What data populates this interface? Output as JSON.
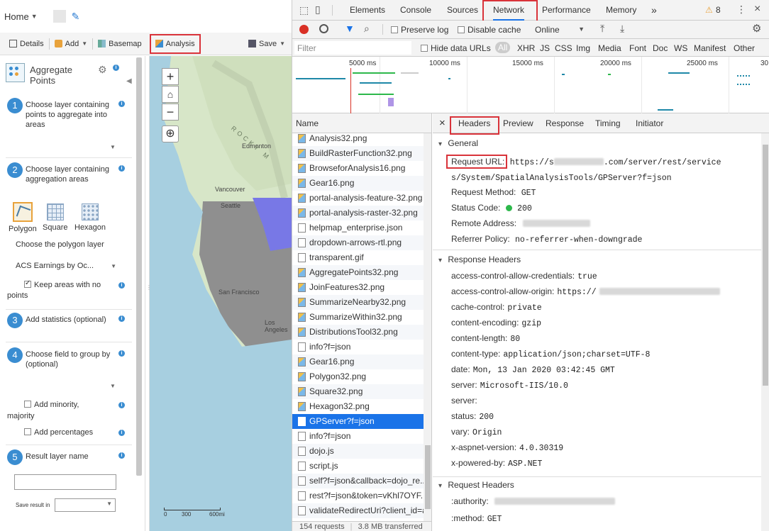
{
  "viewer": {
    "home_label": "Home",
    "toolbar": {
      "details": "Details",
      "add": "Add",
      "basemap": "Basemap",
      "analysis": "Analysis",
      "save": "Save"
    },
    "panel": {
      "title": "Aggregate Points",
      "steps": [
        {
          "num": "1",
          "text": "Choose layer containing points to aggregate into areas"
        },
        {
          "num": "2",
          "text": "Choose layer containing aggregation areas"
        },
        {
          "num": "3",
          "text": "Add statistics (optional)"
        },
        {
          "num": "4",
          "text": "Choose field to group by (optional)"
        },
        {
          "num": "5",
          "text": "Result layer name"
        }
      ],
      "shapes": [
        "Polygon",
        "Square",
        "Hexagon"
      ],
      "choose_polygon": "Choose the polygon layer",
      "polygon_layer": "ACS Earnings by Oc...",
      "keep_areas": "Keep areas with no",
      "keep_areas_2": "points",
      "add_minority": "Add minority,",
      "add_minority_2": "majority",
      "add_percentages": "Add percentages",
      "save_result_in": "Save result in"
    },
    "map": {
      "labels": [
        "Edmonton",
        "Vancouver",
        "Seattle",
        "San Francisco",
        "Los Angeles",
        "ROCKY M"
      ],
      "scale_labels": [
        "0",
        "300",
        "600mi"
      ]
    }
  },
  "devtools": {
    "tabs": [
      "Elements",
      "Console",
      "Sources",
      "Network",
      "Performance",
      "Memory"
    ],
    "active_tab": "Network",
    "more_tabs": "»",
    "warnings": "8",
    "toolbar": {
      "preserve_log": "Preserve log",
      "disable_cache": "Disable cache",
      "throttle": "Online"
    },
    "filter": {
      "placeholder": "Filter",
      "hide_data_urls": "Hide data URLs",
      "types": [
        "All",
        "XHR",
        "JS",
        "CSS",
        "Img",
        "Media",
        "Font",
        "Doc",
        "WS",
        "Manifest",
        "Other"
      ]
    },
    "timeline_ticks": [
      "5000 ms",
      "10000 ms",
      "15000 ms",
      "20000 ms",
      "25000 ms",
      "30"
    ],
    "requests_header": "Name",
    "requests": [
      {
        "name": "Analysis32.png",
        "type": "img"
      },
      {
        "name": "BuildRasterFunction32.png",
        "type": "img"
      },
      {
        "name": "BrowseforAnalysis16.png",
        "type": "img"
      },
      {
        "name": "Gear16.png",
        "type": "img"
      },
      {
        "name": "portal-analysis-feature-32.png",
        "type": "img"
      },
      {
        "name": "portal-analysis-raster-32.png",
        "type": "img"
      },
      {
        "name": "helpmap_enterprise.json",
        "type": "doc"
      },
      {
        "name": "dropdown-arrows-rtl.png",
        "type": "doc"
      },
      {
        "name": "transparent.gif",
        "type": "doc"
      },
      {
        "name": "AggregatePoints32.png",
        "type": "img"
      },
      {
        "name": "JoinFeatures32.png",
        "type": "img"
      },
      {
        "name": "SummarizeNearby32.png",
        "type": "img"
      },
      {
        "name": "SummarizeWithin32.png",
        "type": "img"
      },
      {
        "name": "DistributionsTool32.png",
        "type": "img"
      },
      {
        "name": "info?f=json",
        "type": "doc"
      },
      {
        "name": "Gear16.png",
        "type": "img"
      },
      {
        "name": "Polygon32.png",
        "type": "img"
      },
      {
        "name": "Square32.png",
        "type": "img"
      },
      {
        "name": "Hexagon32.png",
        "type": "img"
      },
      {
        "name": "GPServer?f=json",
        "type": "doc",
        "selected": true
      },
      {
        "name": "info?f=json",
        "type": "doc"
      },
      {
        "name": "dojo.js",
        "type": "doc"
      },
      {
        "name": "script.js",
        "type": "doc"
      },
      {
        "name": "self?f=json&callback=dojo_re...",
        "type": "doc"
      },
      {
        "name": "rest?f=json&token=vKhl7OYF...",
        "type": "doc"
      },
      {
        "name": "validateRedirectUri?client_id=a",
        "type": "doc"
      }
    ],
    "status": {
      "requests": "154 requests",
      "transferred": "3.8 MB transferred"
    },
    "detail_tabs": [
      "Headers",
      "Preview",
      "Response",
      "Timing",
      "Initiator"
    ],
    "detail_active": "Headers",
    "close_glyph": "×",
    "general": {
      "title": "General",
      "request_url_key": "Request URL:",
      "request_url_val_1": "https://s",
      "request_url_val_2": ".com/server/rest/service",
      "request_url_val_3": "s/System/SpatialAnalysisTools/GPServer?f=json",
      "method_key": "Request Method:",
      "method_val": "GET",
      "status_key": "Status Code:",
      "status_val": "200",
      "remote_key": "Remote Address:",
      "referrer_key": "Referrer Policy:",
      "referrer_val": "no-referrer-when-downgrade"
    },
    "response_headers": {
      "title": "Response Headers",
      "items": [
        {
          "k": "access-control-allow-credentials:",
          "v": "true"
        },
        {
          "k": "access-control-allow-origin:",
          "v": "https://"
        },
        {
          "k": "cache-control:",
          "v": "private"
        },
        {
          "k": "content-encoding:",
          "v": "gzip"
        },
        {
          "k": "content-length:",
          "v": "80"
        },
        {
          "k": "content-type:",
          "v": "application/json;charset=UTF-8"
        },
        {
          "k": "date:",
          "v": "Mon, 13 Jan 2020 03:42:45 GMT"
        },
        {
          "k": "server:",
          "v": "Microsoft-IIS/10.0"
        },
        {
          "k": "server:",
          "v": ""
        },
        {
          "k": "status:",
          "v": "200"
        },
        {
          "k": "vary:",
          "v": "Origin"
        },
        {
          "k": "x-aspnet-version:",
          "v": "4.0.30319"
        },
        {
          "k": "x-powered-by:",
          "v": "ASP.NET"
        }
      ]
    },
    "request_headers": {
      "title": "Request Headers",
      "items": [
        {
          "k": ":authority:",
          "v": ""
        },
        {
          "k": ":method:",
          "v": "GET"
        }
      ]
    },
    "colors": {
      "accent": "#1a73e8",
      "highlight": "#d9333a",
      "status_ok": "#2db84b"
    }
  }
}
